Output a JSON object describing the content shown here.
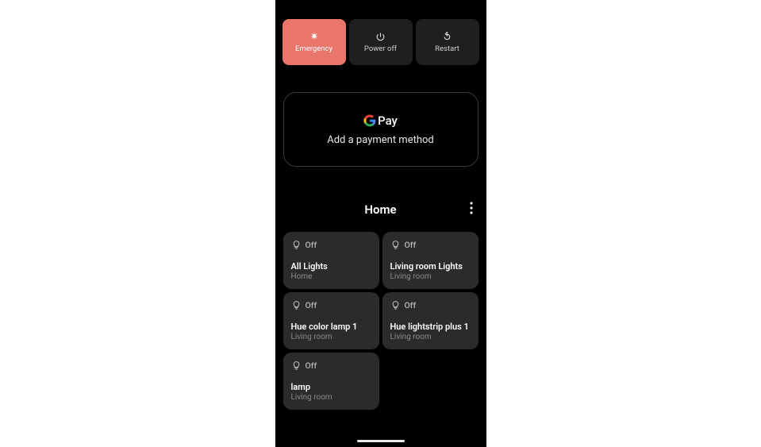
{
  "power": {
    "emergency": "Emergency",
    "poweroff": "Power off",
    "restart": "Restart"
  },
  "gpay": {
    "brand": "Pay",
    "prompt": "Add a payment method"
  },
  "home": {
    "title": "Home"
  },
  "tiles": [
    {
      "state": "Off",
      "name": "All Lights",
      "loc": "Home"
    },
    {
      "state": "Off",
      "name": "Living room Lights",
      "loc": "Living room"
    },
    {
      "state": "Off",
      "name": "Hue color lamp 1",
      "loc": "Living room"
    },
    {
      "state": "Off",
      "name": "Hue lightstrip plus 1",
      "loc": "Living room"
    },
    {
      "state": "Off",
      "name": "lamp",
      "loc": "Living room"
    }
  ]
}
